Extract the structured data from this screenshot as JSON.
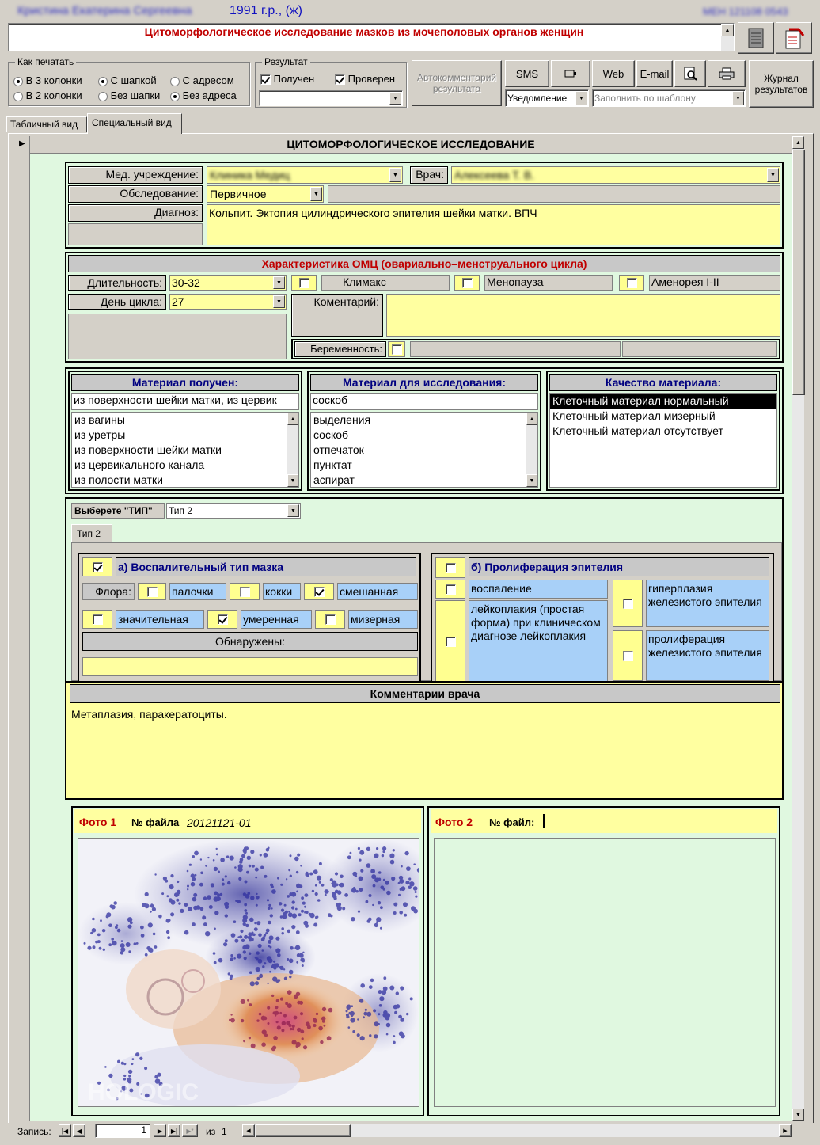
{
  "title_bar": {
    "patient_name": "Кристина Екатерина Сергеевна",
    "birth": "1991 г.р., (ж)",
    "record_id": "МЕН 121108 0543"
  },
  "form_title": "Цитоморфологическое исследование мазков из мочеполовых органов женщин",
  "print_group": {
    "legend": "Как печатать",
    "options": [
      {
        "label": "В 3 колонки",
        "checked": true
      },
      {
        "label": "С шапкой",
        "checked": true
      },
      {
        "label": "С адресом",
        "checked": false
      },
      {
        "label": "В 2 колонки",
        "checked": false
      },
      {
        "label": "Без шапки",
        "checked": false
      },
      {
        "label": "Без адреса",
        "checked": true
      }
    ]
  },
  "result_group": {
    "legend": "Результат",
    "received": "Получен",
    "checked": "Проверен",
    "select_value": ""
  },
  "toolbar": {
    "autocomment": "Автокомментарий результата",
    "sms": "SMS",
    "web": "Web",
    "email": "E-mail",
    "journal": "Журнал результатов",
    "notify": "Уведомление",
    "fill_template": "Заполнить по шаблону"
  },
  "tabs": {
    "table_view": "Табличный вид",
    "special_view": "Специальный вид"
  },
  "section_title": "ЦИТОМОРФОЛОГИЧЕСКОЕ ИССЛЕДОВАНИЕ",
  "patient_info": {
    "med_label": "Мед. учреждение:",
    "med_value": "Клиника Медиц",
    "doctor_label": "Врач:",
    "doctor_value": "Алексеева Т. В.",
    "exam_label": "Обследование:",
    "exam_value": "Первичное",
    "diag_label": "Диагноз:",
    "diag_value": "Кольпит. Эктопия цилиндрического эпителия шейки матки. ВПЧ"
  },
  "omc": {
    "title": "Характеристика ОМЦ (овариально–менструального цикла)",
    "duration_label": "Длительность:",
    "duration_value": "30-32",
    "climax": "Климакс",
    "menopause": "Менопауза",
    "amenorrhea": "Аменорея I-II",
    "day_label": "День цикла:",
    "day_value": "27",
    "comment_label": "Коментарий:",
    "pregnancy_label": "Беременность:"
  },
  "material": {
    "received_title": "Материал получен:",
    "received_value": "из поверхности шейки матки, из цервик",
    "received_list": [
      "из вагины",
      "из уретры",
      "из поверхности шейки матки",
      "из цервикального канала",
      "из полости матки"
    ],
    "study_title": "Материал для исследования:",
    "study_value": "соскоб",
    "study_list": [
      "выделения",
      "соскоб",
      "отпечаток",
      "пунктат",
      "аспират"
    ],
    "quality_title": "Качество материала:",
    "quality_list": [
      "Клеточный материал нормальный",
      "Клеточный материал мизерный",
      "Клеточный материал отсутствует"
    ]
  },
  "type": {
    "label": "Выберете \"ТИП\"",
    "value": "Тип 2",
    "tab": "Тип 2"
  },
  "inflam": {
    "title": "а) Воспалительный тип мазка",
    "flora": "Флора:",
    "sticks": "палочки",
    "cocci": "кокки",
    "mixed": "смешанная",
    "significant": "значительная",
    "moderate": "умеренная",
    "meager": "мизерная",
    "found": "Обнаружены:"
  },
  "prolif": {
    "title": "б) Пролиферация эпителия",
    "inflammation": "воспаление",
    "leukoplakia": "лейкоплакия (простая форма) при клиническом диагнозе лейкоплакия",
    "hyperplasia": "гиперплазия железистого эпителия",
    "proliferation": "пролиферация железистого эпителия"
  },
  "comments": {
    "title": "Комментарии врача",
    "text": "Метаплазия, паракератоциты."
  },
  "photo1": {
    "label": "Фото 1",
    "file_label": "№ файла",
    "file_value": "20121121-01",
    "watermark": "HOLOGIC"
  },
  "photo2": {
    "label": "Фото 2",
    "file_label": "№ файл:"
  },
  "nav": {
    "record_label": "Запись:",
    "current": "1",
    "of": "из",
    "total": "1"
  }
}
